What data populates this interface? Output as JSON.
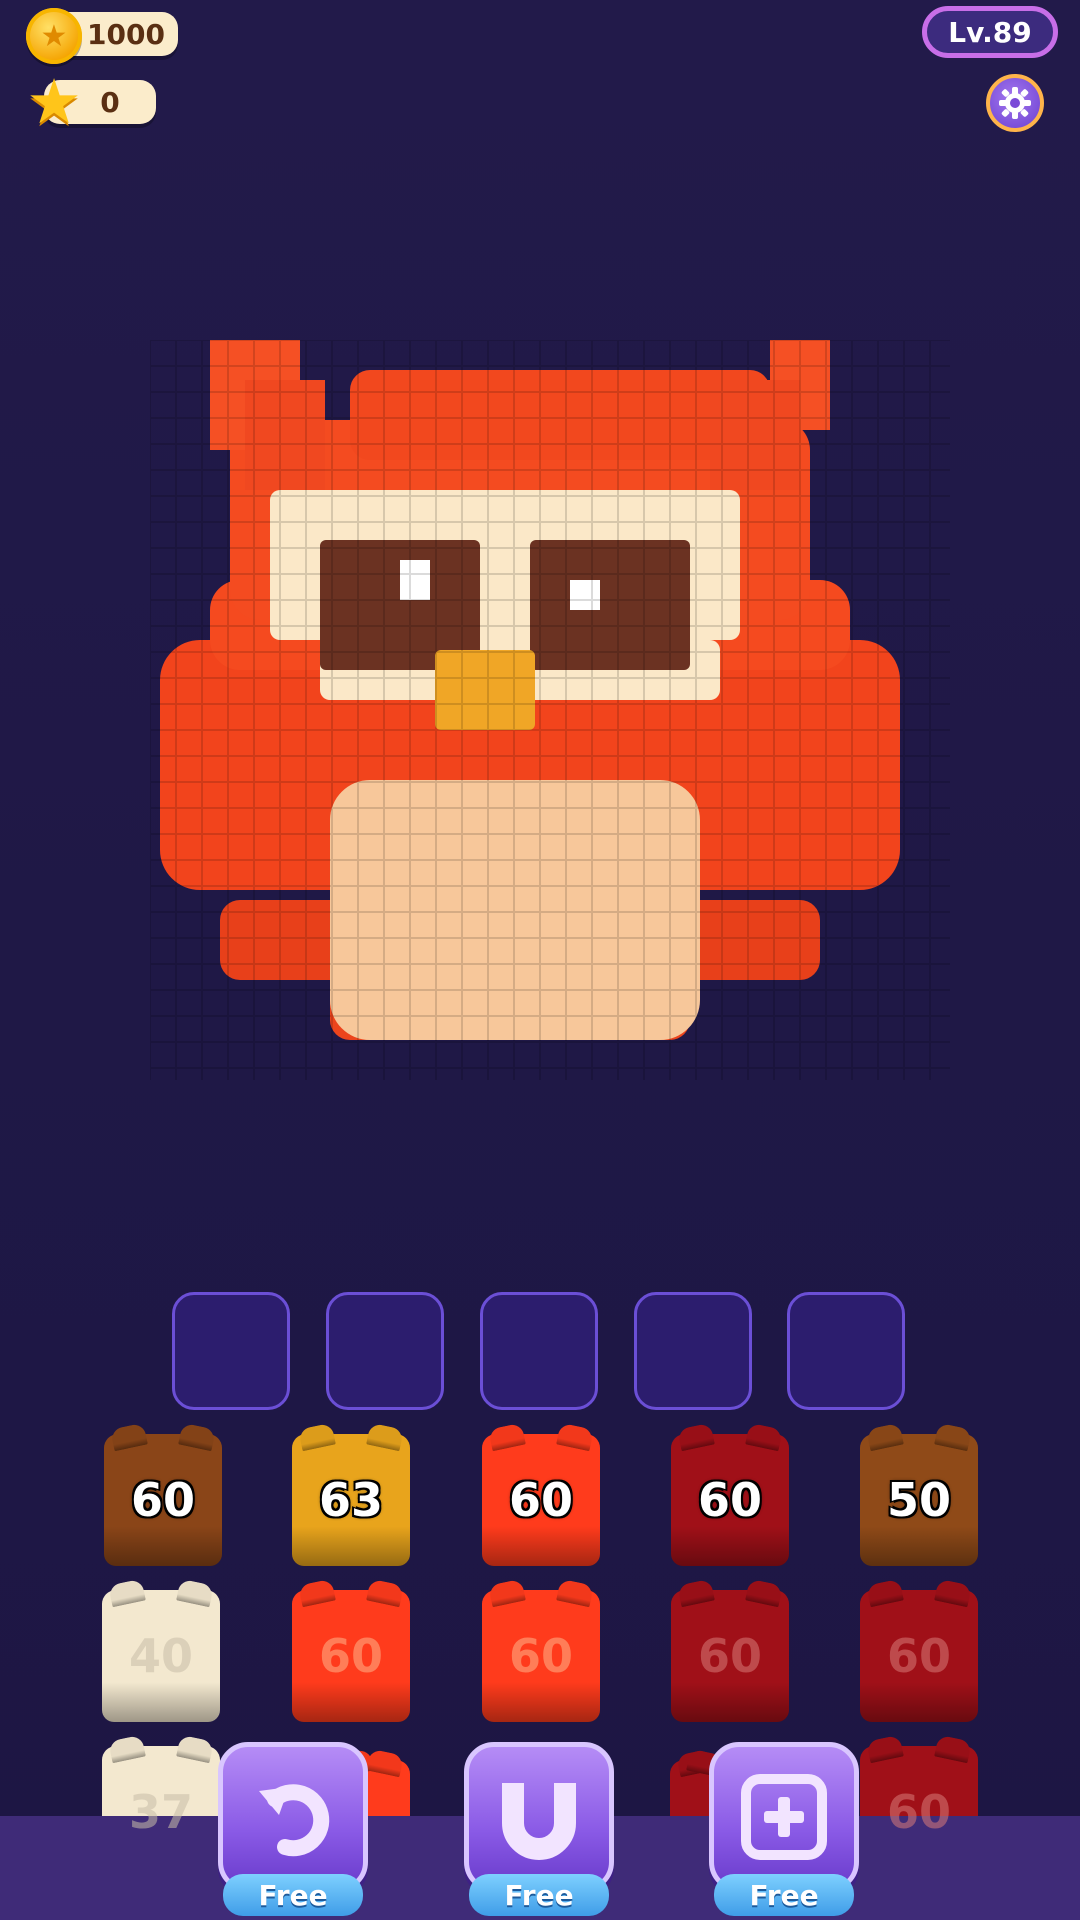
{
  "hud": {
    "coins": "1000",
    "stars": "0",
    "level": "Lv.89"
  },
  "icons": {
    "coin": "coin-icon",
    "star": "star-icon",
    "settings": "gear-icon",
    "undo": "undo-arrow-icon",
    "magnet": "magnet-icon",
    "add_slot": "plus-square-icon"
  },
  "slots": [
    "",
    "",
    "",
    "",
    ""
  ],
  "blocks": {
    "row1": [
      {
        "value": "60",
        "color": "#8a4518"
      },
      {
        "value": "63",
        "color": "#e8a41c"
      },
      {
        "value": "60",
        "color": "#ff3b1c"
      },
      {
        "value": "60",
        "color": "#a01018"
      },
      {
        "value": "50",
        "color": "#8f4a18"
      }
    ],
    "row2": [
      {
        "value": "40",
        "color": "#f3e8cf"
      },
      {
        "value": "60",
        "color": "#ff3b1c"
      },
      {
        "value": "60",
        "color": "#ff3b1c"
      },
      {
        "value": "60",
        "color": "#a01018"
      },
      {
        "value": "60",
        "color": "#a01018"
      }
    ],
    "row3": [
      {
        "value": "37",
        "color": "#f3e8cf"
      },
      {
        "value": "60",
        "color": "#a01018"
      }
    ]
  },
  "boosters": [
    {
      "label": "Free",
      "icon": "undo-arrow-icon"
    },
    {
      "label": "Free",
      "icon": "magnet-icon"
    },
    {
      "label": "Free",
      "icon": "plus-square-icon"
    }
  ]
}
